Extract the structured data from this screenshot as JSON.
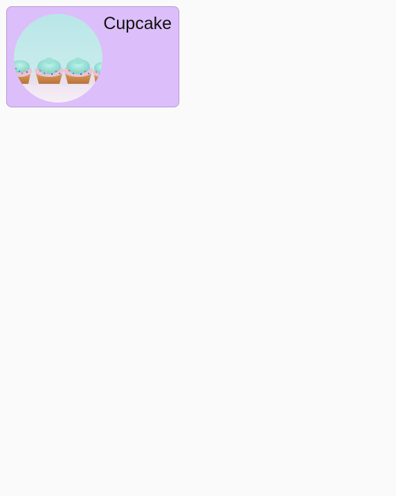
{
  "card": {
    "title": "Cupcake",
    "image_icon": "cupcake-image",
    "background_color": "#dcbefa",
    "border_color": "#b89ad4"
  },
  "page": {
    "background_color": "#fafafa"
  }
}
